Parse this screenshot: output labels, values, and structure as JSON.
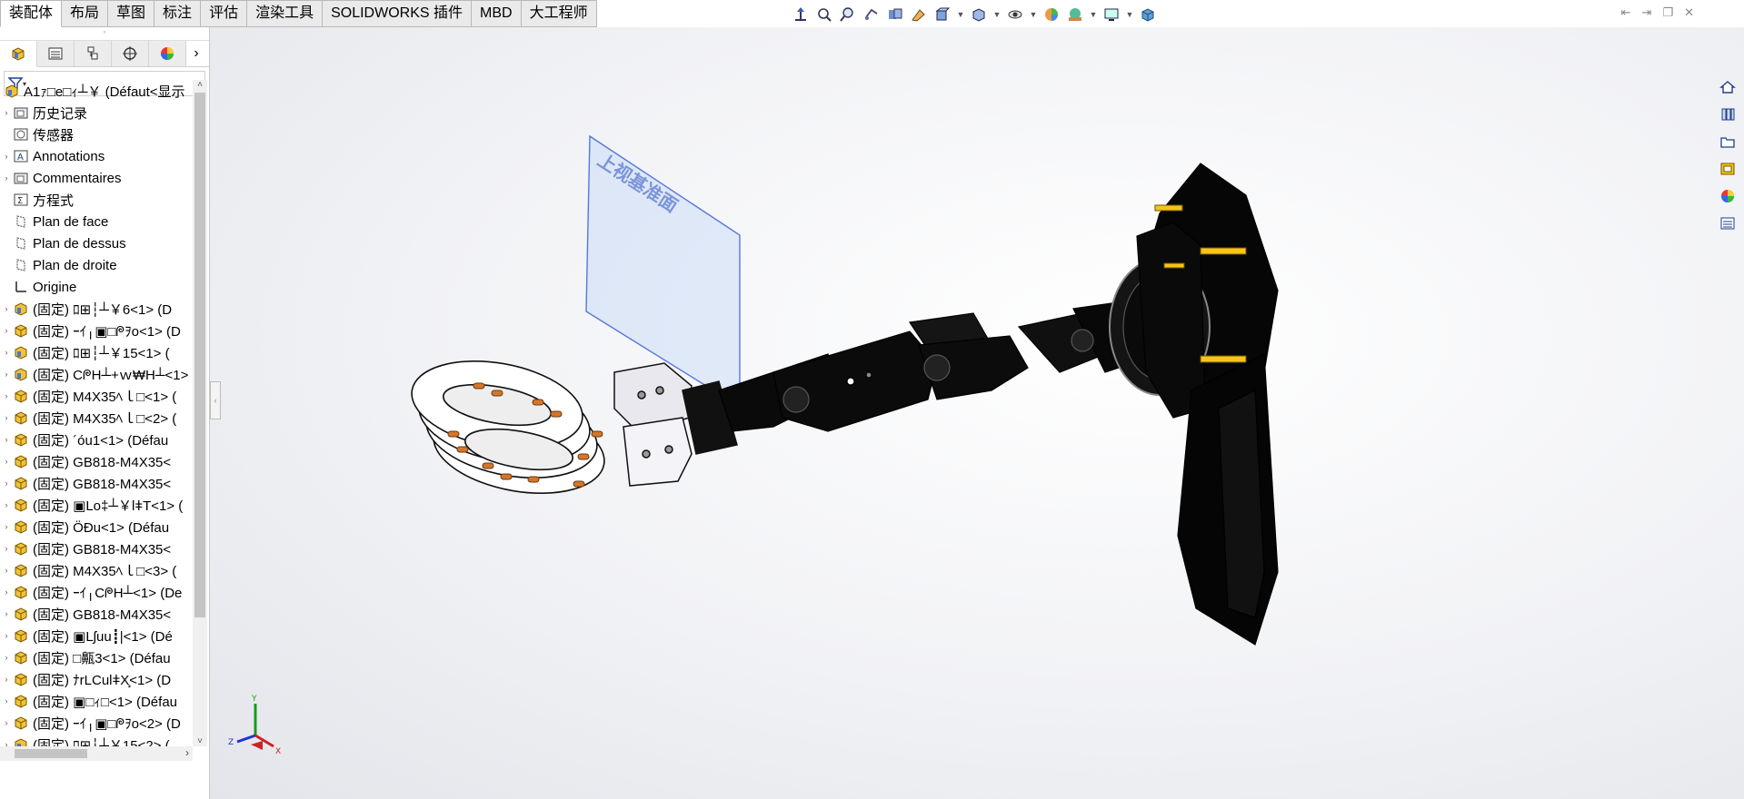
{
  "tabs": [
    "装配体",
    "布局",
    "草图",
    "标注",
    "评估",
    "渲染工具",
    "SOLIDWORKS 插件",
    "MBD",
    "大工程师"
  ],
  "view_tools": [
    "vertical-arrow",
    "zoom-to-fit",
    "zoom-area",
    "previous-view",
    "section-view",
    "dynamic-annotation",
    "view-orientation",
    "display-style",
    "hide-show",
    "edit-appearance",
    "scene",
    "view-settings",
    "cube"
  ],
  "tree": {
    "root": "A1ｧ□e□ｨ┴￥  (Défaut<显示",
    "items": [
      {
        "label": "历史记录",
        "icon": "folder",
        "exp": true
      },
      {
        "label": "传感器",
        "icon": "sensor",
        "exp": false
      },
      {
        "label": "Annotations",
        "icon": "annotation",
        "exp": true
      },
      {
        "label": "Commentaires",
        "icon": "folder",
        "exp": true
      },
      {
        "label": "方程式",
        "icon": "equation",
        "exp": false
      },
      {
        "label": "Plan de face",
        "icon": "plane",
        "exp": false
      },
      {
        "label": "Plan de dessus",
        "icon": "plane",
        "exp": false
      },
      {
        "label": "Plan de droite",
        "icon": "plane",
        "exp": false
      },
      {
        "label": "Origine",
        "icon": "origin",
        "exp": false
      },
      {
        "label": "(固定) ﾛ⊞┆┴￥6<1> (D",
        "icon": "subasm",
        "exp": true
      },
      {
        "label": "(固定) ｰｲ╷▣□ᖘｦo<1> (D",
        "icon": "part",
        "exp": true
      },
      {
        "label": "(固定) ﾛ⊞┆┴￥15<1> (",
        "icon": "subasm",
        "exp": true
      },
      {
        "label": "(固定) CᖘH┴+ｗ₩H┴<1> (",
        "icon": "subasm",
        "exp": true
      },
      {
        "label": "(固定) M4X35ﾍｌ□<1> (",
        "icon": "part",
        "exp": true
      },
      {
        "label": "(固定) M4X35ﾍｌ□<2> (",
        "icon": "part",
        "exp": true
      },
      {
        "label": "(固定) ´óu1<1> (Défau",
        "icon": "part",
        "exp": true
      },
      {
        "label": "(固定) GB818-M4X35<",
        "icon": "part",
        "exp": true
      },
      {
        "label": "(固定) GB818-M4X35<",
        "icon": "part",
        "exp": true
      },
      {
        "label": "(固定) ▣Lo‡┴￥lǂT<1> (",
        "icon": "part",
        "exp": true
      },
      {
        "label": "(固定) ÖÐu<1> (Défau",
        "icon": "part",
        "exp": true
      },
      {
        "label": "(固定) GB818-M4X35<",
        "icon": "part",
        "exp": true
      },
      {
        "label": "(固定) M4X35ﾍｌ□<3> (",
        "icon": "part",
        "exp": true
      },
      {
        "label": "(固定) ｰｲ╷CᖘH┴<1> (De",
        "icon": "part",
        "exp": true
      },
      {
        "label": "(固定) GB818-M4X35<",
        "icon": "part",
        "exp": true
      },
      {
        "label": "(固定) ▣Lʃuu┋|<1> (Dé",
        "icon": "part",
        "exp": true
      },
      {
        "label": "(固定) □齀3<1> (Défau",
        "icon": "part",
        "exp": true
      },
      {
        "label": "(固定) ﾅrLCulǂX̧<1> (D",
        "icon": "part",
        "exp": true
      },
      {
        "label": "(固定) ▣□ｨ□<1> (Défau",
        "icon": "part",
        "exp": true
      },
      {
        "label": "(固定) ｰｲ╷▣□ᖘｦo<2> (D",
        "icon": "part",
        "exp": true
      },
      {
        "label": "(固定) ﾛ⊞┆┴￥15<2> (",
        "icon": "subasm",
        "exp": true
      }
    ]
  },
  "viewport": {
    "plane_label": "上视基准面",
    "triad": {
      "x": "X",
      "y": "Y",
      "z": "Z"
    }
  },
  "colors": {
    "yellow": "#f5c518",
    "orange": "#d5762a",
    "plane": "#5577dd"
  }
}
